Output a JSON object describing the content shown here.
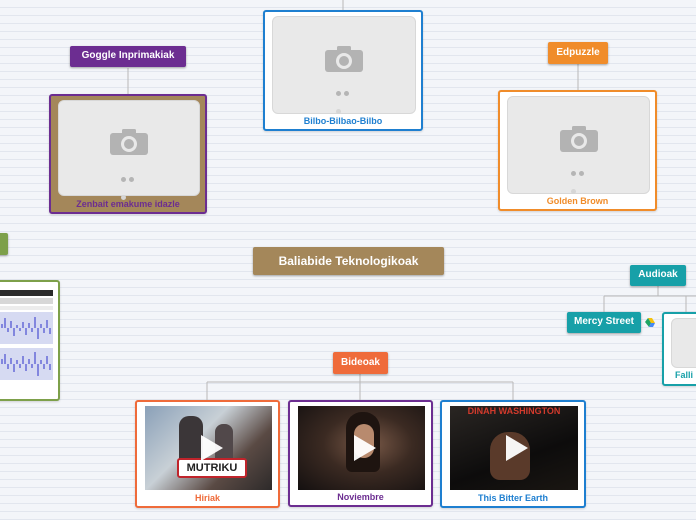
{
  "central": {
    "label": "Baliabide Teknologikoak"
  },
  "nodes": {
    "goggle": {
      "label": "Goggle Inprimakiak",
      "card_caption": "Zenbait emakume idazle"
    },
    "bilbo": {
      "card_caption": "Bilbo-Bilbao-Bilbo"
    },
    "edpuzzle": {
      "label": "Edpuzzle",
      "card_caption": "Golden Brown"
    },
    "audioak": {
      "label": "Audioak"
    },
    "mercy": {
      "label": "Mercy Street"
    },
    "falli": {
      "card_caption": "Falli"
    },
    "bideoak": {
      "label": "Bideoak",
      "videos": [
        {
          "caption": "Hiriak",
          "overlay_text": "MUTRIKU"
        },
        {
          "caption": "Noviembre"
        },
        {
          "caption": "This Bitter Earth",
          "overlay_text": "DINAH WASHINGTON"
        }
      ]
    }
  },
  "colors": {
    "central": "#a4875a",
    "purple": "#6c2d91",
    "blue": "#1e7fd0",
    "orange": "#f08c2a",
    "teal": "#17a0a8",
    "bideoak": "#ef6b3a",
    "green": "#7da04a"
  },
  "icons": {
    "photo_placeholder": "camera-icon",
    "play": "play-icon",
    "cloud": "cloud-drive-icon"
  }
}
